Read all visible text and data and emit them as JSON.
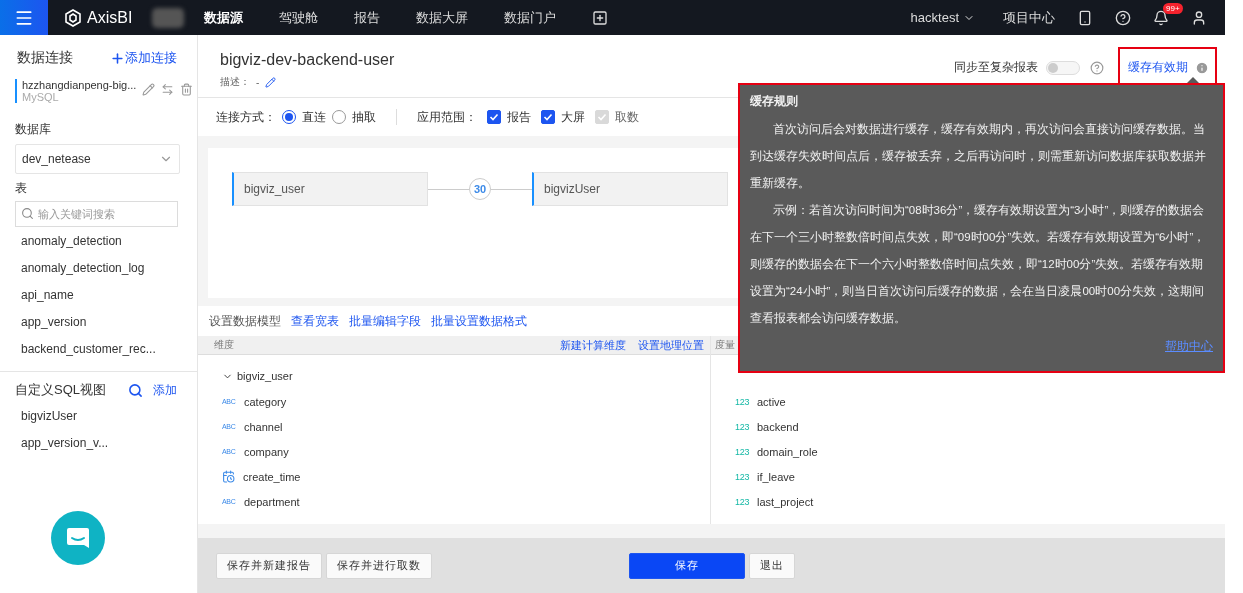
{
  "navbar": {
    "logo": "AxisBI",
    "items": [
      {
        "label": "数据源",
        "selected": true
      },
      {
        "label": "驾驶舱",
        "selected": false
      },
      {
        "label": "报告",
        "selected": false
      },
      {
        "label": "数据大屏",
        "selected": false
      },
      {
        "label": "数据门户",
        "selected": false
      }
    ],
    "user": "hacktest",
    "project_center": "项目中心",
    "notification_badge": "99+"
  },
  "sidebar": {
    "title": "数据连接",
    "add_button": "添加连接",
    "connection": {
      "name": "hzzhangdianpeng-big...",
      "type": "MySQL",
      "selected": true
    },
    "database_label": "数据库",
    "database": "dev_netease",
    "table_label": "表",
    "table_search_placeholder": "输入关键词搜索",
    "tables": [
      "anomaly_detection",
      "anomaly_detection_log",
      "api_name",
      "app_version",
      "backend_customer_rec..."
    ],
    "sql_views_title": "自定义SQL视图",
    "sql_add": "添加",
    "sql_views": [
      "bigvizUser",
      "app_version_v..."
    ]
  },
  "header": {
    "title": "bigviz-dev-backend-user",
    "description_label": "描述：",
    "description": "-",
    "sync_label": "同步至复杂报表",
    "sync_on": false,
    "cache_link": "缓存有效期"
  },
  "options": {
    "connection_label": "连接方式：",
    "modes": [
      {
        "label": "直连",
        "selected": true
      },
      {
        "label": "抽取",
        "selected": false
      }
    ],
    "scope_label": "应用范围：",
    "scopes": [
      {
        "label": "报告",
        "checked": true,
        "disabled": false
      },
      {
        "label": "大屏",
        "checked": true,
        "disabled": false
      },
      {
        "label": "取数",
        "checked": true,
        "disabled": true
      }
    ]
  },
  "join": {
    "left": "bigviz_user",
    "count": "30",
    "right": "bigvizUser"
  },
  "model_toolbar": {
    "title": "设置数据模型",
    "links": [
      "查看宽表",
      "批量编辑字段",
      "批量设置数据格式"
    ]
  },
  "dimensions": {
    "header": "维度",
    "actions": [
      "新建计算维度",
      "设置地理位置"
    ],
    "group": "bigviz_user",
    "expanded": true,
    "fields": [
      {
        "name": "category",
        "kind": "text",
        "type_label": "ABC"
      },
      {
        "name": "channel",
        "kind": "text",
        "type_label": "ABC"
      },
      {
        "name": "company",
        "kind": "text",
        "type_label": "ABC"
      },
      {
        "name": "create_time",
        "kind": "date"
      },
      {
        "name": "department",
        "kind": "text",
        "type_label": "ABC"
      }
    ]
  },
  "measures": {
    "header": "度量",
    "fields": [
      {
        "name": "active",
        "kind": "number",
        "type_label": "123"
      },
      {
        "name": "backend",
        "kind": "number",
        "type_label": "123"
      },
      {
        "name": "domain_role",
        "kind": "number",
        "type_label": "123"
      },
      {
        "name": "if_leave",
        "kind": "number",
        "type_label": "123"
      },
      {
        "name": "last_project",
        "kind": "number",
        "type_label": "123"
      }
    ]
  },
  "tooltip": {
    "title": "缓存规则",
    "paragraphs": [
      "首次访问后会对数据进行缓存，缓存有效期内，再次访问会直接访问缓存数据。当到达缓存失效时间点后，缓存被丢弃，之后再访问时，则需重新访问数据库获取数据并重新缓存。",
      "示例：若首次访问时间为“08时36分”，缓存有效期设置为“3小时”，则缓存的数据会在下一个三小时整数倍时间点失效，即“09时00分”失效。若缓存有效期设置为“6小时”，则缓存的数据会在下一个六小时整数倍时间点失效，即“12时00分”失效。若缓存有效期设置为“24小时”，则当日首次访问后缓存的数据，会在当日凌晨00时00分失效，这期间查看报表都会访问缓存数据。"
    ],
    "help_link": "帮助中心"
  },
  "footer": {
    "buttons": [
      {
        "label": "保存并新建报告",
        "kind": "default"
      },
      {
        "label": "保存并进行取数",
        "kind": "default"
      },
      {
        "label": "保存",
        "kind": "primary"
      },
      {
        "label": "退出",
        "kind": "default"
      }
    ]
  }
}
